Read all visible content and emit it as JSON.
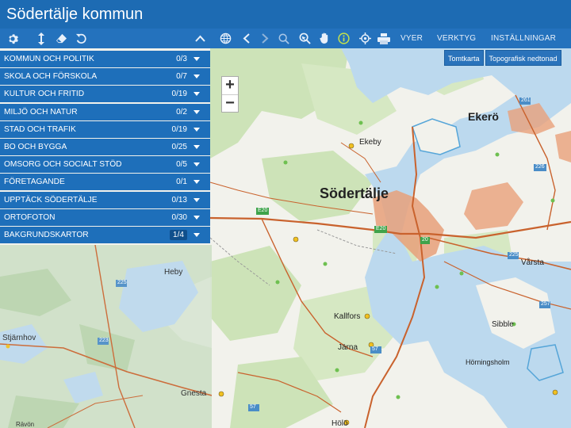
{
  "header": {
    "title": "Södertälje kommun"
  },
  "toolbar": {
    "icons": [
      "gear-icon",
      "resize-vertical-icon",
      "eraser-icon",
      "undo-icon",
      "chevron-up-icon",
      "globe-icon",
      "chevron-left-icon",
      "chevron-right-icon",
      "search-icon",
      "search-select-icon",
      "hand-icon",
      "info-icon",
      "locate-icon",
      "print-icon"
    ],
    "views_label": "VYER",
    "tools_label": "VERKTYG",
    "settings_label": "INSTÄLLNINGAR"
  },
  "background_buttons": {
    "tomtkarta": "Tomtkarta",
    "topo": "Topografisk nedtonad"
  },
  "layers": [
    {
      "name": "KOMMUN OCH POLITIK",
      "count": "0/3"
    },
    {
      "name": "SKOLA OCH FÖRSKOLA",
      "count": "0/7"
    },
    {
      "name": "KULTUR OCH FRITID",
      "count": "0/19"
    },
    {
      "name": "MILJÖ OCH NATUR",
      "count": "0/2"
    },
    {
      "name": "STAD OCH TRAFIK",
      "count": "0/19"
    },
    {
      "name": "BO OCH BYGGA",
      "count": "0/25"
    },
    {
      "name": "OMSORG OCH SOCIALT STÖD",
      "count": "0/5"
    },
    {
      "name": "FÖRETAGANDE",
      "count": "0/1"
    },
    {
      "name": "UPPTÄCK SÖDERTÄLJE",
      "count": "0/13"
    },
    {
      "name": "ORTOFOTON",
      "count": "0/30"
    },
    {
      "name": "BAKGRUNDSKARTOR",
      "count": "1/4"
    }
  ],
  "zoom": {
    "in": "+",
    "out": "−"
  },
  "map_labels": {
    "sodertalje": "Södertälje",
    "ekero": "Ekerö",
    "ekeby": "Ekeby",
    "varsta": "Vårsta",
    "kallfors": "Kallfors",
    "sibble": "Sibble",
    "jarna": "Järna",
    "horningsholm": "Hörningsholm",
    "holo": "Hölö",
    "heby": "Heby",
    "stjarnhov": "Stjärnhov",
    "gnesta": "Gnesta",
    "rauon": "Rävön"
  },
  "road_numbers": [
    "261",
    "E20",
    "E20",
    "20",
    "225",
    "225",
    "57",
    "57",
    "226",
    "257",
    "223",
    "225",
    "57",
    "224",
    "223",
    "57"
  ]
}
